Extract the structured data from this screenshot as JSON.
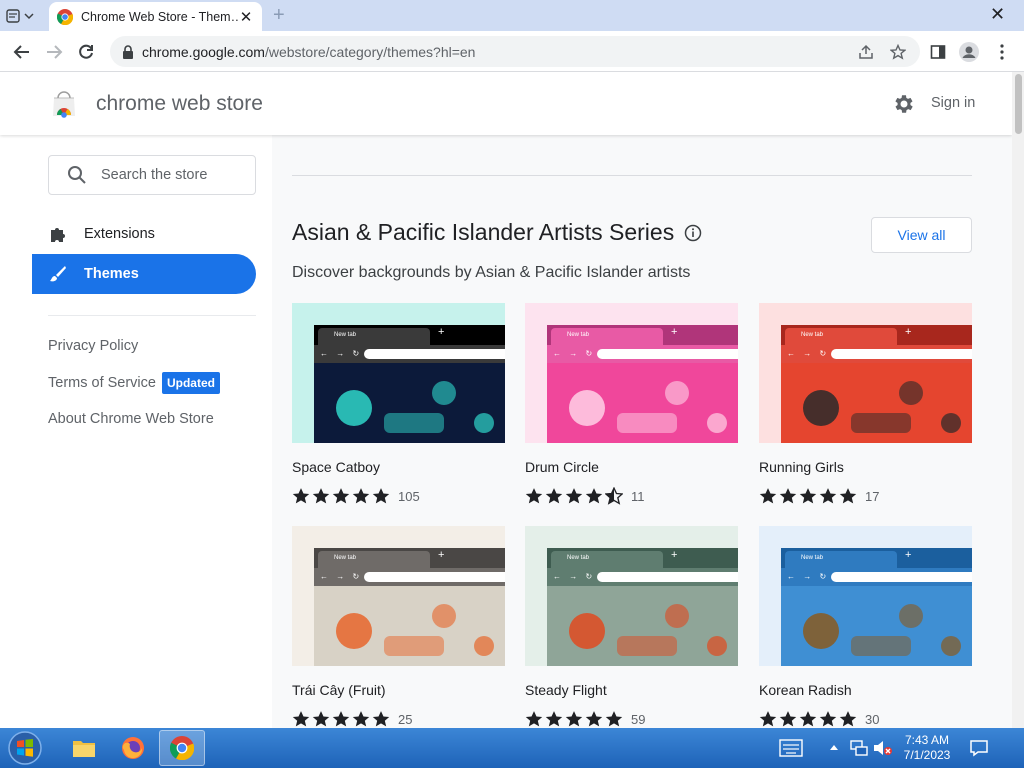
{
  "browser": {
    "tab_title": "Chrome Web Store - Them…",
    "tab_close": "✕",
    "new_tab": "+",
    "window_close": "✕",
    "url_host": "chrome.google.com",
    "url_path": "/webstore/category/themes?hl=en"
  },
  "header": {
    "title": "chrome web store",
    "signin": "Sign in"
  },
  "sidebar": {
    "search_placeholder": "Search the store",
    "nav": [
      {
        "label": "Extensions",
        "icon": "puzzle-icon",
        "active": false
      },
      {
        "label": "Themes",
        "icon": "brush-icon",
        "active": true
      }
    ],
    "links": {
      "privacy": "Privacy Policy",
      "terms": "Terms of Service",
      "terms_badge": "Updated",
      "about": "About Chrome Web Store"
    }
  },
  "main": {
    "series_title": "Asian & Pacific Islander Artists Series",
    "view_all": "View all",
    "subtitle": "Discover backgrounds by Asian & Pacific Islander artists",
    "cards": [
      {
        "name": "Space Catboy",
        "rating": 5,
        "count": "105",
        "theme_bg": "#c6f2ec",
        "toolbar": "#000000",
        "tab": "#3a3a3a",
        "art": "#0c1a3a",
        "accent": "#2fd6c9"
      },
      {
        "name": "Drum Circle",
        "rating": 4.5,
        "count": "11",
        "theme_bg": "#fde3ef",
        "toolbar": "#b0357a",
        "tab": "#e85aa5",
        "art": "#f0479b",
        "accent": "#ffd0e6"
      },
      {
        "name": "Running Girls",
        "rating": 5,
        "count": "17",
        "theme_bg": "#fde0e0",
        "toolbar": "#a8271d",
        "tab": "#e04a3b",
        "art": "#e5452f",
        "accent": "#2a2a2a"
      },
      {
        "name": "Trái Cây (Fruit)",
        "rating": 5,
        "count": "25",
        "theme_bg": "#f3eee7",
        "toolbar": "#4a4745",
        "tab": "#6f6b68",
        "art": "#d8d2c6",
        "accent": "#e7662b"
      },
      {
        "name": "Steady Flight",
        "rating": 5,
        "count": "59",
        "theme_bg": "#e4efe9",
        "toolbar": "#3e5c50",
        "tab": "#5f7d70",
        "art": "#8fa598",
        "accent": "#e04a20"
      },
      {
        "name": "Korean Radish",
        "rating": 5,
        "count": "30",
        "theme_bg": "#e4effa",
        "toolbar": "#1b5f9e",
        "tab": "#2f7bc0",
        "art": "#3f8fd3",
        "accent": "#8a5a1f"
      }
    ]
  },
  "mini_ui": {
    "tab_label": "New tab",
    "plus": "+",
    "nav": "← → ↻"
  },
  "taskbar": {
    "time": "7:43 AM",
    "date": "7/1/2023"
  }
}
